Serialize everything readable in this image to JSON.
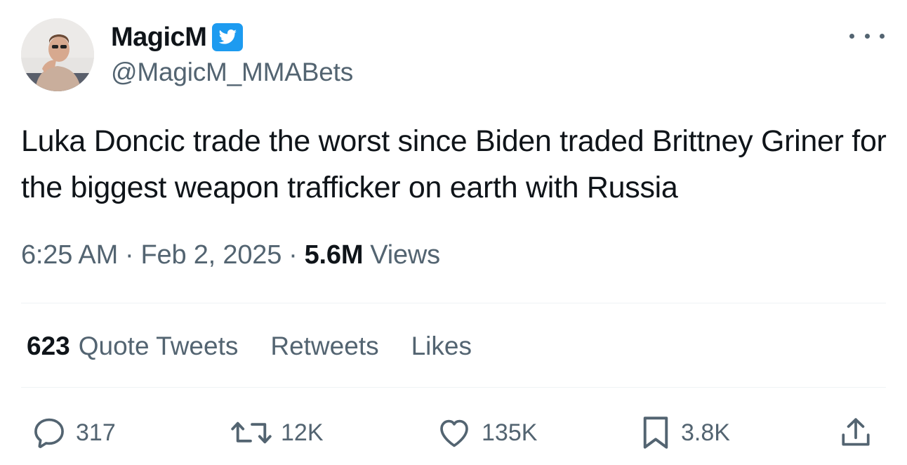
{
  "user": {
    "display_name": "MagicM",
    "handle": "@MagicM_MMABets",
    "verified_icon": "twitter-bird-verified-badge",
    "badge_color": "#1d9bf0"
  },
  "tweet": {
    "text": "Luka Doncic trade the worst since Biden traded Brittney Griner for the biggest weapon trafficker on earth with Russia",
    "time": "6:25 AM",
    "date": "Feb 2, 2025",
    "separator": "·",
    "views_count": "5.6M",
    "views_label": "Views"
  },
  "stats": {
    "quote_tweets_count": "623",
    "quote_tweets_label": "Quote Tweets",
    "retweets_label": "Retweets",
    "likes_label": "Likes"
  },
  "actions": {
    "reply": {
      "icon": "reply-icon",
      "count": "317"
    },
    "retweet": {
      "icon": "retweet-icon",
      "count": "12K"
    },
    "like": {
      "icon": "heart-icon",
      "count": "135K"
    },
    "bookmark": {
      "icon": "bookmark-icon",
      "count": "3.8K"
    },
    "share": {
      "icon": "share-icon"
    }
  },
  "colors": {
    "text_primary": "#0f1419",
    "text_secondary": "#536471",
    "divider": "#eff3f4"
  }
}
